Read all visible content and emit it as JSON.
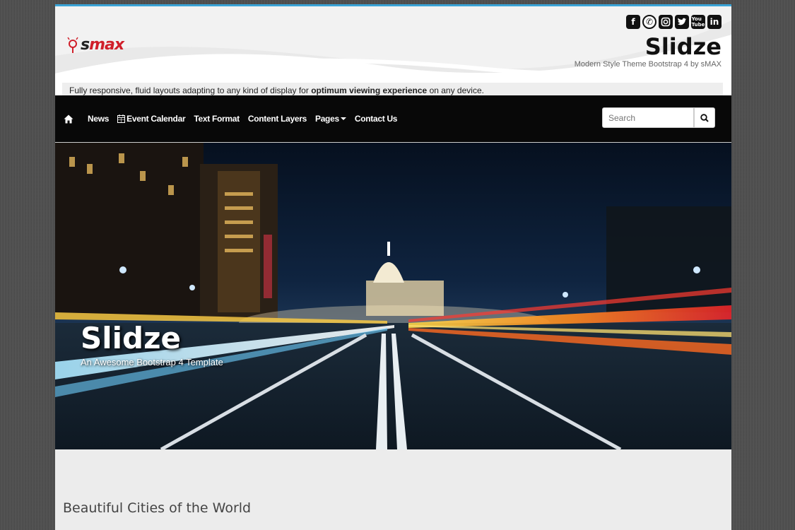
{
  "header": {
    "logo_text_a": "s",
    "logo_text_b": "max",
    "site_title": "Slidze",
    "site_subtitle": "Modern Style Theme Bootstrap 4 by sMAX",
    "social_icons": [
      "facebook-icon",
      "whatsapp-icon",
      "instagram-icon",
      "twitter-icon",
      "youtube-icon",
      "linkedin-icon"
    ],
    "tagline_pre": "Fully responsive, fluid layouts adapting to any kind of display for ",
    "tagline_bold": "optimum viewing experience",
    "tagline_post": " on any device."
  },
  "nav": {
    "home_icon": "home-icon",
    "items": [
      "News",
      "Event Calendar",
      "Text Format",
      "Content Layers",
      "Pages",
      "Contact Us"
    ],
    "search_placeholder": "Search"
  },
  "hero": {
    "title": "Slidze",
    "subtitle": "An Awesome Bootstrap 4 Template"
  },
  "content": {
    "heading": "Beautiful Cities of the World"
  },
  "colors": {
    "accent": "#3aa3d6",
    "navbar": "#080808",
    "logo_red": "#d01f2a"
  }
}
